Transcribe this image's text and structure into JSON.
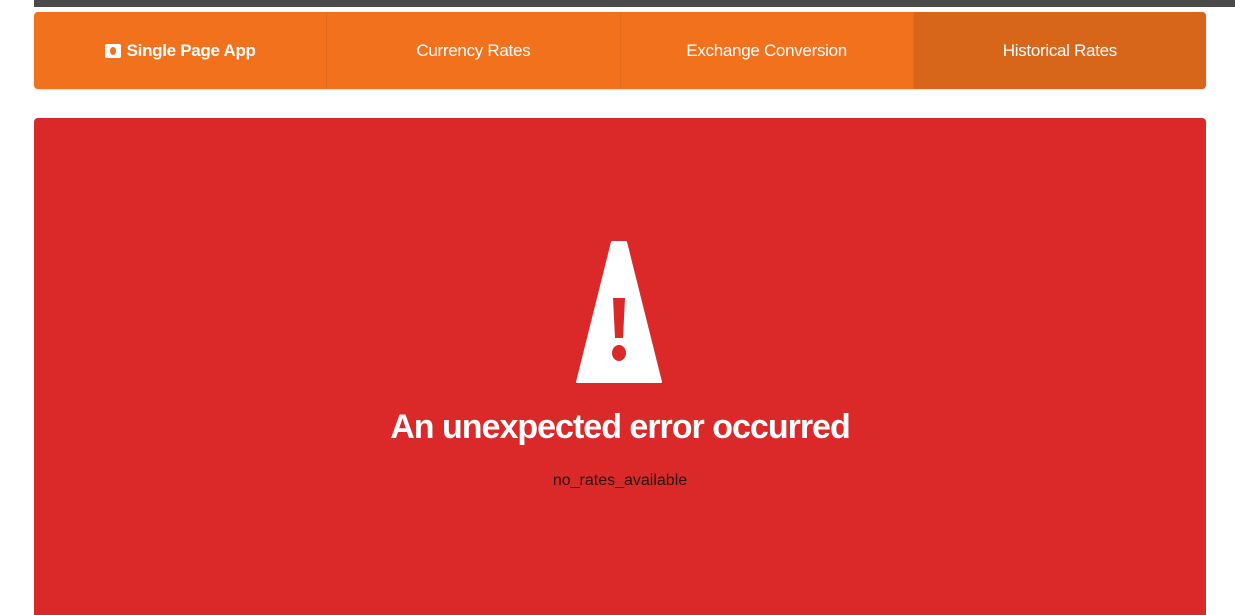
{
  "nav": {
    "brand": {
      "label": "Single Page App",
      "icon": "money-icon"
    },
    "items": [
      {
        "label": "Currency Rates",
        "active": false
      },
      {
        "label": "Exchange Conversion",
        "active": false
      },
      {
        "label": "Historical Rates",
        "active": true
      }
    ]
  },
  "error": {
    "icon": "warning-icon",
    "title": "An unexpected error occurred",
    "message": "no_rates_available"
  },
  "colors": {
    "nav_bg": "#f2711c",
    "nav_active_bg": "#d8661a",
    "error_bg": "#db2828",
    "text_light": "#ffffff"
  }
}
